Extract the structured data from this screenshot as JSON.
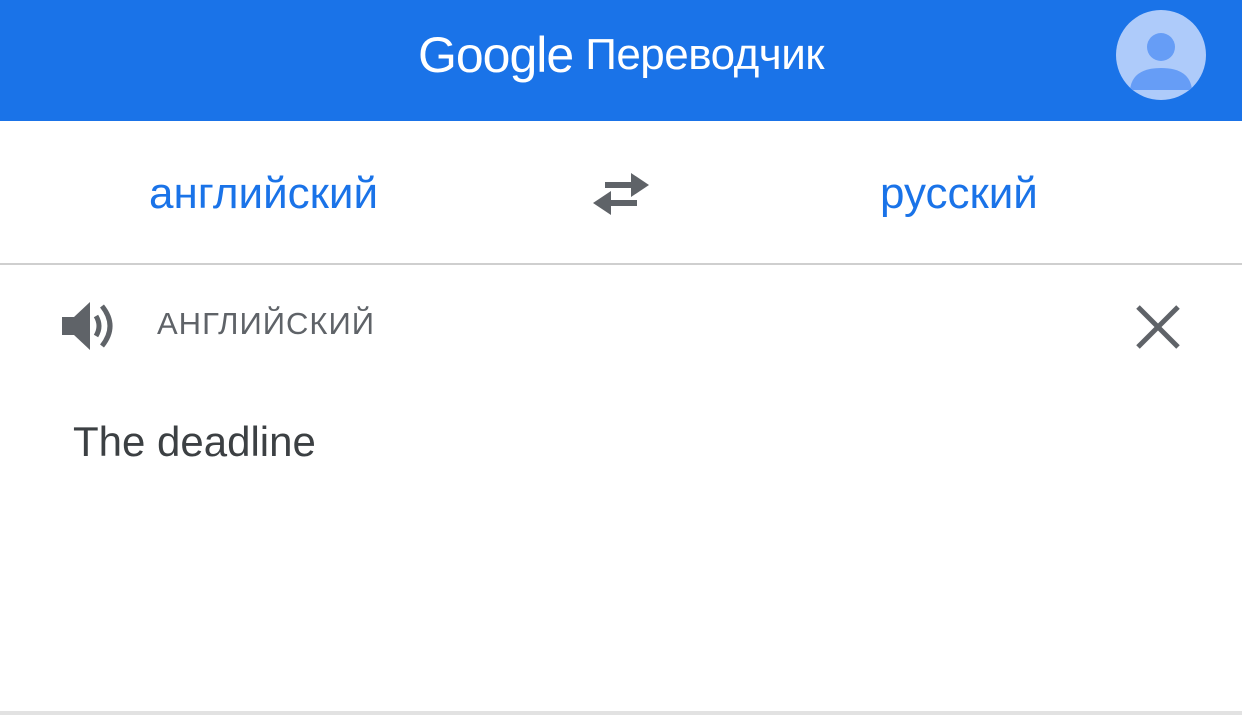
{
  "header": {
    "logo_text": "Google",
    "product_name": "Переводчик",
    "background_color": "#1a73e8",
    "avatar_icon": "account-icon"
  },
  "languages": {
    "source": "английский",
    "target": "русский",
    "swap_icon": "swap-arrows-icon"
  },
  "input": {
    "language_caption": "АНГЛИЙСКИЙ",
    "text": "The deadline",
    "speaker_icon": "speaker-icon",
    "clear_icon": "close-icon"
  },
  "colors": {
    "accent": "#1a73e8",
    "icon_gray": "#5f6368",
    "text": "#3c4043"
  }
}
